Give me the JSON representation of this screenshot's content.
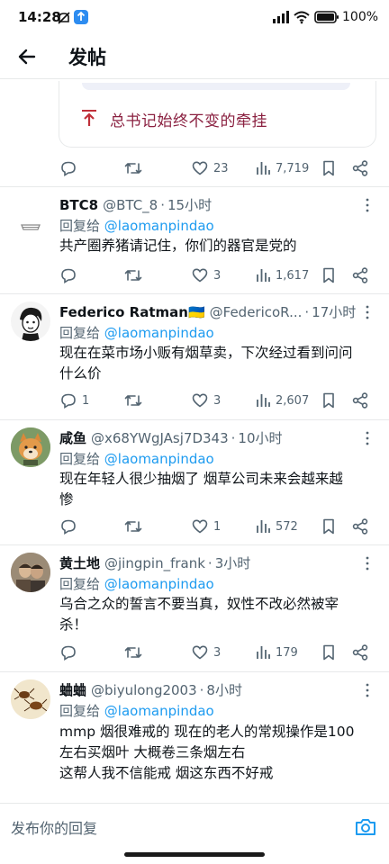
{
  "status_bar": {
    "time": "14:28",
    "battery": "100%"
  },
  "header": {
    "title": "发帖"
  },
  "quote_card": {
    "text": "总书记始终不变的牵挂"
  },
  "main_actions": {
    "likes": "23",
    "views": "7,719"
  },
  "replies": [
    {
      "name": "BTC8",
      "handle": "@BTC_8",
      "time": "15小时",
      "reply_to_prefix": "回复给 ",
      "reply_to_handle": "@laomanpindao",
      "text": "共产圈养猪请记住，你们的器官是党的",
      "replies_count": "",
      "likes": "3",
      "views": "1,617"
    },
    {
      "name": "Federico Ratman🇺🇦",
      "handle": "@FedericoR...",
      "time": "17小时",
      "reply_to_prefix": "回复给 ",
      "reply_to_handle": "@laomanpindao",
      "text": "现在在菜市场小贩有烟草卖，下次经过看到问问\n什么价",
      "replies_count": "1",
      "likes": "3",
      "views": "2,607"
    },
    {
      "name": "咸鱼",
      "handle": "@x68YWgJAsj7D343",
      "time": "10小时",
      "reply_to_prefix": "回复给 ",
      "reply_to_handle": "@laomanpindao",
      "text": "现在年轻人很少抽烟了 烟草公司未来会越来越\n惨",
      "replies_count": "",
      "likes": "1",
      "views": "572"
    },
    {
      "name": "黄土地",
      "handle": "@jingpin_frank",
      "time": "3小时",
      "reply_to_prefix": "回复给 ",
      "reply_to_handle": "@laomanpindao",
      "text": "乌合之众的誓言不要当真，奴性不改必然被宰\n杀！",
      "replies_count": "",
      "likes": "3",
      "views": "179"
    },
    {
      "name": "蛐蛐",
      "handle": "@biyulong2003",
      "time": "8小时",
      "reply_to_prefix": "回复给 ",
      "reply_to_handle": "@laomanpindao",
      "text": "mmp 烟很难戒的 现在的老人的常规操作是100\n左右买烟叶 大概卷三条烟左右\n这帮人我不信能戒 烟这东西不好戒",
      "replies_count": "",
      "likes": "",
      "views": ""
    }
  ],
  "compose": {
    "placeholder": "发布你的回复"
  },
  "colors": {
    "accent": "#1d9bf0",
    "text": "#0f1419",
    "secondary": "#536471",
    "divider": "#e7e9ea"
  }
}
